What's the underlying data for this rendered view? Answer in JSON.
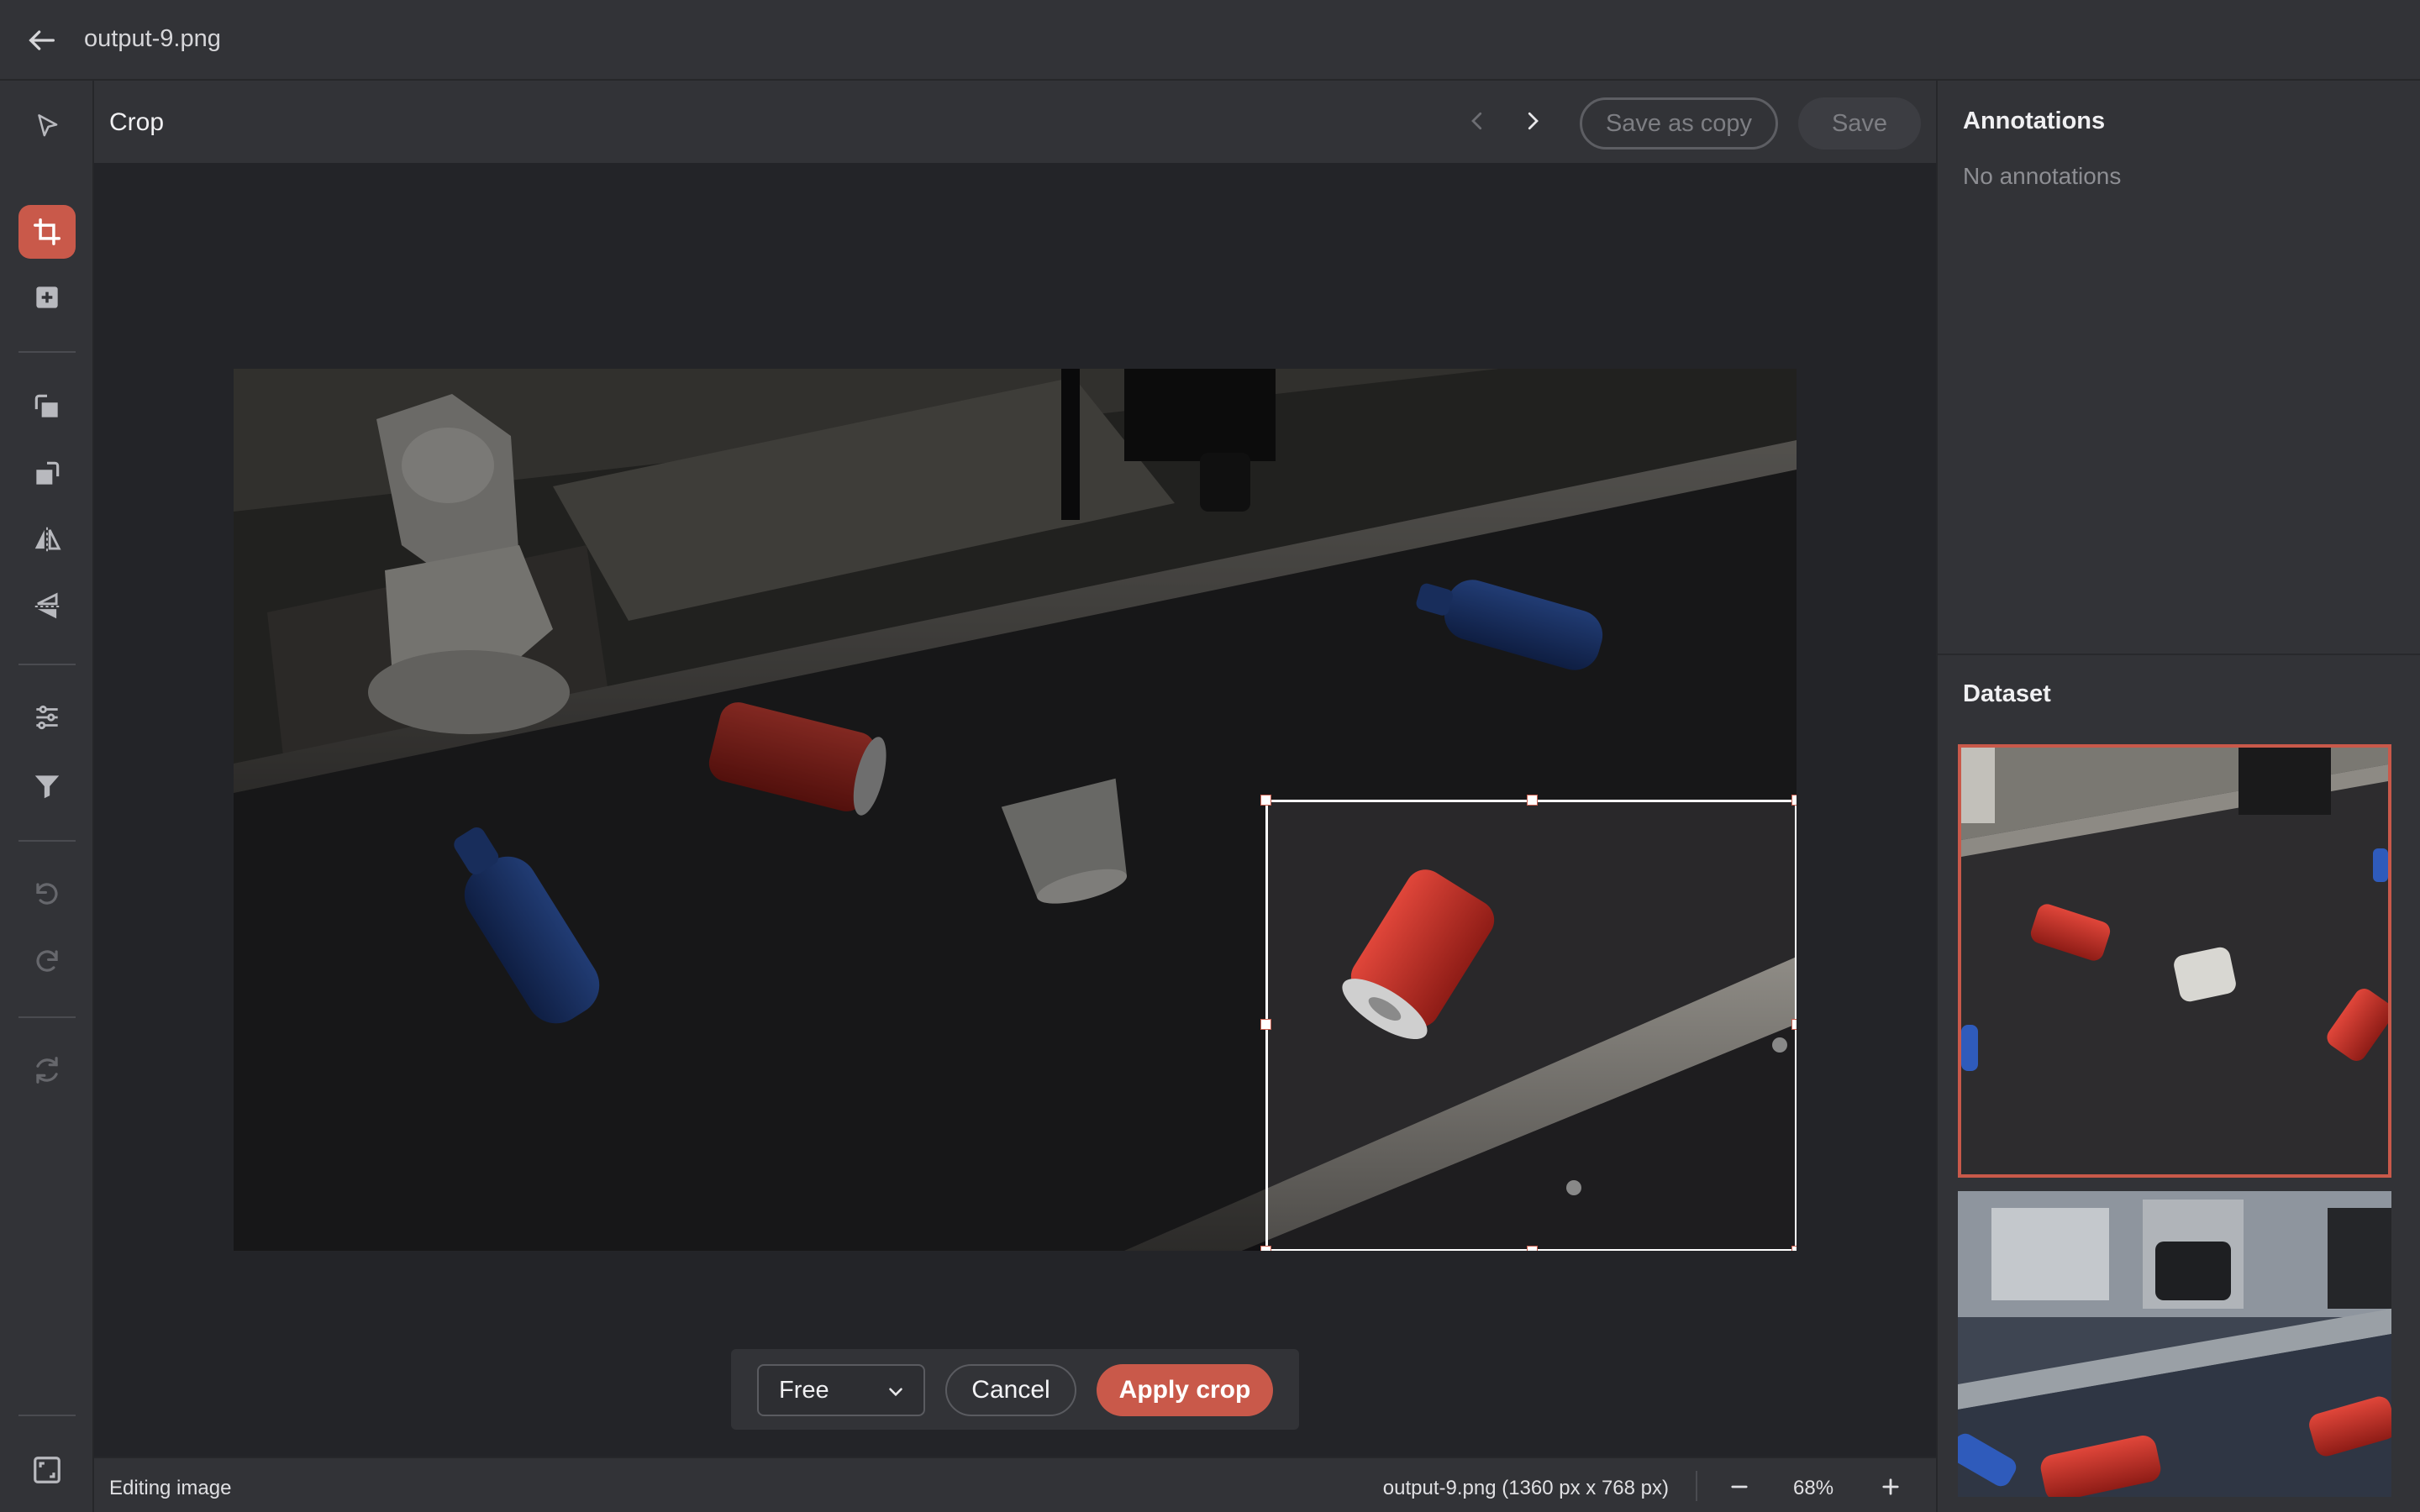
{
  "topbar": {
    "file_title": "output-9.png"
  },
  "toolbar": {
    "tools": [
      {
        "name": "select-tool",
        "icon": "pointer-icon"
      },
      {
        "name": "crop-tool",
        "icon": "crop-icon",
        "active": true
      },
      {
        "name": "add-annotation-tool",
        "icon": "plus-square-icon"
      },
      {
        "name": "rotate-left-tool",
        "icon": "rotate-left-icon"
      },
      {
        "name": "rotate-right-tool",
        "icon": "rotate-right-icon"
      },
      {
        "name": "flip-horizontal-tool",
        "icon": "flip-horizontal-icon"
      },
      {
        "name": "flip-vertical-tool",
        "icon": "flip-vertical-icon"
      },
      {
        "name": "adjustments-tool",
        "icon": "sliders-icon"
      },
      {
        "name": "filter-tool",
        "icon": "filter-icon"
      },
      {
        "name": "undo-tool",
        "icon": "undo-icon"
      },
      {
        "name": "redo-tool",
        "icon": "redo-icon"
      },
      {
        "name": "reset-tool",
        "icon": "refresh-icon"
      },
      {
        "name": "fullscreen-tool",
        "icon": "fullscreen-icon"
      }
    ]
  },
  "header": {
    "mode_title": "Crop",
    "save_as_copy_label": "Save as copy",
    "save_label": "Save"
  },
  "crop_controls": {
    "ratio_value": "Free",
    "cancel_label": "Cancel",
    "apply_label": "Apply crop"
  },
  "status": {
    "left_text": "Editing image",
    "file_info": "output-9.png (1360 px x 768 px)",
    "zoom": "68%"
  },
  "annotations_panel": {
    "title": "Annotations",
    "empty_text": "No annotations"
  },
  "dataset_panel": {
    "title": "Dataset"
  },
  "colors": {
    "accent": "#c9594a",
    "bg": "#2b2c30",
    "panel": "#323337"
  }
}
